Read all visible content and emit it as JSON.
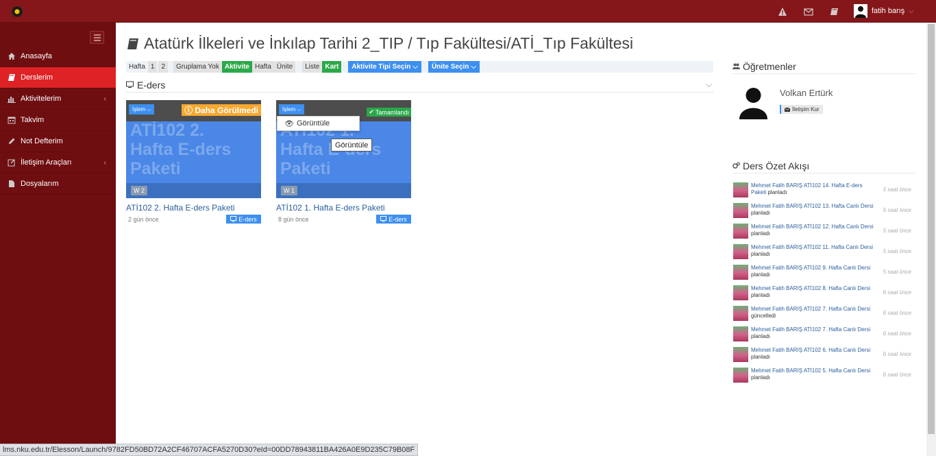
{
  "topbar": {
    "user_name": "fatih barış"
  },
  "sidebar": {
    "items": [
      {
        "label": "Anasayfa"
      },
      {
        "label": "Derslerim"
      },
      {
        "label": "Aktivitelerim"
      },
      {
        "label": "Takvim"
      },
      {
        "label": "Not Defterim"
      },
      {
        "label": "İletişim Araçları"
      },
      {
        "label": "Dosyalarım"
      }
    ]
  },
  "main": {
    "title": "Atatürk İlkeleri ve İnkılap Tarihi 2_TIP / Tıp Fakültesi/ATİ_Tıp Fakültesi",
    "filters": {
      "hafta_label": "Hafta",
      "week1": "1",
      "week2": "2",
      "gruplama_yok": "Gruplama Yok",
      "aktivite": "Aktivite",
      "hafta": "Hafta",
      "unite": "Ünite",
      "liste": "Liste",
      "kart": "Kart",
      "aktivite_tipi": "Aktivite Tipi Seçin",
      "unite_sec": "Ünite Seçin"
    },
    "section_title": "E-ders",
    "cards": [
      {
        "islem": "İşlem",
        "status": "Daha Görülmedi",
        "big_text": "ATİ102 2.\nHafta E-ders\nPaketi",
        "week": "W 2",
        "title": "ATİ102 2. Hafta E-ders Paketi",
        "ago": "2 gün önce",
        "tag": "E-ders"
      },
      {
        "islem": "İşlem",
        "status": "Tamamlandı",
        "big_text": "ATİ102 1.\nHafta E-ders\nPaketi",
        "week": "W 1",
        "title": "ATİ102 1. Hafta E-ders Paketi",
        "ago": "8 gün önce",
        "tag": "E-ders"
      }
    ],
    "dropdown_item": "Görüntüle",
    "tooltip": "Görüntüle"
  },
  "right": {
    "teachers_title": "Öğretmenler",
    "teacher_name": "Volkan Ertürk",
    "contact_label": "İletişim Kur",
    "feed_title": "Ders Özet Akışı",
    "feed": [
      {
        "text": "Mehmet Fatih BARIŞ ATİ102 14. Hafta E-ders Paketi",
        "action": "planladı",
        "time": "5 saat önce"
      },
      {
        "text": "Mehmet Fatih BARIŞ ATİ102 13. Hafta Canlı Dersi",
        "action": "planladı",
        "time": "5 saat önce"
      },
      {
        "text": "Mehmet Fatih BARIŞ ATİ102 12. Hafta Canlı Dersi",
        "action": "planladı",
        "time": "5 saat önce"
      },
      {
        "text": "Mehmet Fatih BARIŞ ATİ102 11. Hafta Canlı Dersi",
        "action": "planladı",
        "time": "5 saat önce"
      },
      {
        "text": "Mehmet Fatih BARIŞ ATİ102 9. Hafta Canlı Dersi",
        "action": "planladı",
        "time": "5 saat önce"
      },
      {
        "text": "Mehmet Fatih BARIŞ ATİ102 8. Hafta Canlı Dersi",
        "action": "planladı",
        "time": "6 saat önce"
      },
      {
        "text": "Mehmet Fatih BARIŞ ATİ102 7. Hafta Canlı Dersi",
        "action": "güncelledi",
        "time": "6 saat önce"
      },
      {
        "text": "Mehmet Fatih BARIŞ ATİ102 7. Hafta Canlı Dersi",
        "action": "planladı",
        "time": "6 saat önce"
      },
      {
        "text": "Mehmet Fatih BARIŞ ATİ102 6. Hafta Canlı Dersi",
        "action": "planladı",
        "time": "6 saat önce"
      },
      {
        "text": "Mehmet Fatih BARIŞ ATİ102 5. Hafta Canlı Dersi",
        "action": "planladı",
        "time": "6 saat önce"
      }
    ]
  },
  "statusbar": {
    "url": "lms.nku.edu.tr/Elesson/Launch/9782FD50BD72A2CF46707ACFA5270D30?eId=00DD78943811BA426A0E9D235C79B08F"
  },
  "colors": {
    "topbar": "#85171b",
    "sidebar": "#6f0e11",
    "active_menu": "#df2226",
    "accent_blue": "#3d8ff0",
    "success_green": "#2ba84a",
    "warning_orange": "#f7a830"
  }
}
